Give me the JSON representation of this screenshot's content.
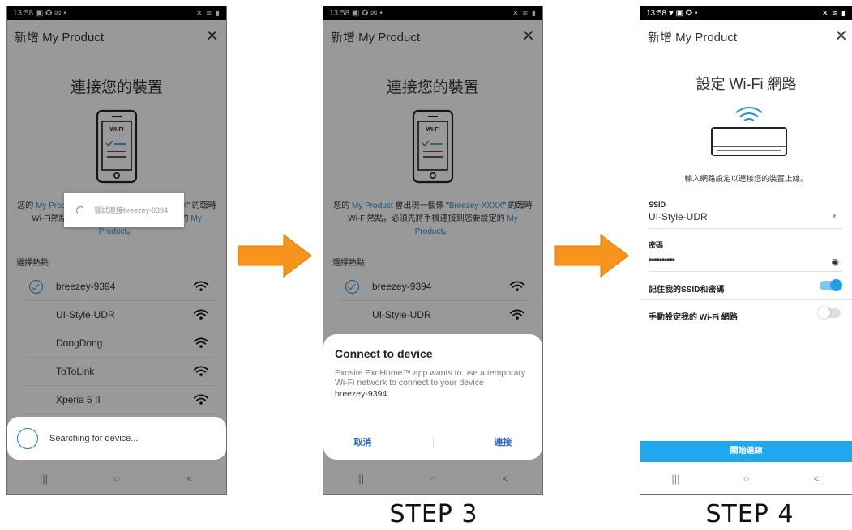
{
  "status_time": "13:58",
  "status_icons_left": "▣ ✪ ✉ •",
  "status_icons_left_p3": "♥ ▣ ✪ •",
  "status_icons_right": "✕ ≋ ▮",
  "app_title": "新增 My Product",
  "nav": {
    "recent": "|||",
    "home": "○",
    "back": "<"
  },
  "connect": {
    "title": "連接您的裝置",
    "wifi_label": "WI-FI",
    "desc_a": "您的 ",
    "desc_product": "My Product",
    "desc_b": " 會出現一個像 \"",
    "desc_ssid": "Breezey-XXXX",
    "desc_c": "\" 的臨時Wi-Fi熱點，必須先將手機連接到您要設定的 ",
    "desc_product2": "My Product",
    "desc_d": "。",
    "choose_label": "選擇熱點",
    "hotspots": [
      "breezey-9394",
      "UI-Style-UDR",
      "DongDong",
      "ToToLink",
      "Xperia 5 II"
    ]
  },
  "toast_text": "嘗試連接breezey-9394",
  "searching_text": "Searching for device...",
  "dialog": {
    "title": "Connect to device",
    "body": "Exosite ExoHome™ app wants to use a temporary Wi-Fi network to connect to your device",
    "network": "breezey-9394",
    "cancel": "取消",
    "connect": "連接"
  },
  "wifi_setup": {
    "title": "設定 Wi-Fi 網路",
    "instruction": "輸入網路設定以連接您的裝置上線。",
    "ssid_label": "SSID",
    "ssid_value": "UI-Style-UDR",
    "password_label": "密碼",
    "password_value": "••••••••••",
    "remember_label": "記住我的SSID和密碼",
    "remember_on": true,
    "manual_label": "手動設定我的 Wi-Fi 網路",
    "manual_on": false,
    "start_button": "開始連線"
  },
  "steps": {
    "step3": "STEP 3",
    "step4": "STEP 4"
  },
  "colors": {
    "accent": "#2a8fd6",
    "arrow": "#f7941d",
    "button": "#20a8ef"
  }
}
